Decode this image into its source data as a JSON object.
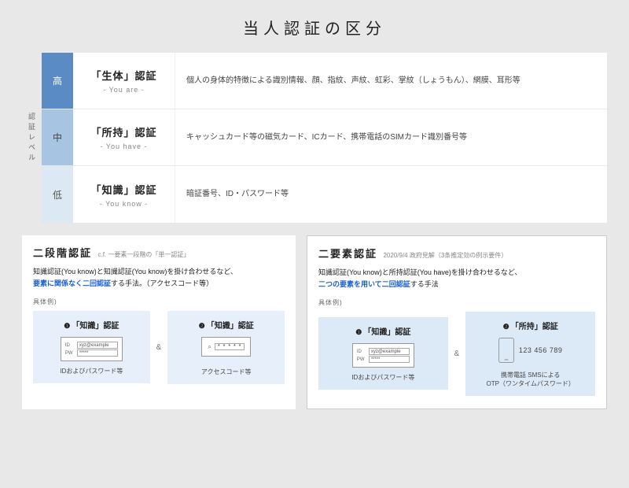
{
  "title": "当人認証の区分",
  "sideLabel": "認証レベル",
  "levels": [
    {
      "level": "高",
      "catTitle": "「生体」認証",
      "catSub": "- You are -",
      "desc": "個人の身体的特徴による識別情報、顔、指紋、声紋、虹彩、掌紋（しょうもん）、網膜、耳形等"
    },
    {
      "level": "中",
      "catTitle": "「所持」認証",
      "catSub": "- You have -",
      "desc": "キャッシュカード等の磁気カード、ICカード、携帯電話のSIMカード識別番号等"
    },
    {
      "level": "低",
      "catTitle": "「知識」認証",
      "catSub": "- You know -",
      "desc": "暗証番号、ID・パスワード等"
    }
  ],
  "twoStep": {
    "title": "二段階認証",
    "note": "c.f. 一要素一段階の「単一認証」",
    "desc1": "知識認証(You know)と知識認証(You know)を掛け合わせるなど、",
    "descHL": "要素に関係なく二回認証",
    "desc2": "する手法。（アクセスコード等）",
    "exampleLabel": "具体例)",
    "card1Title": "「知識」認証",
    "card2Title": "「知識」認証",
    "idLabel": "ID",
    "pwLabel": "PW",
    "idValue": "xyz@example",
    "pwValue": "*****",
    "card1Caption": "IDおよびパスワード等",
    "accessDots": "* * * * *",
    "card2Caption": "アクセスコード等",
    "amp": "&"
  },
  "twoFactor": {
    "title": "二要素認証",
    "note": "2020/9/4 政府見解（3条推定効の例示要件）",
    "desc1": "知識認証(You know)と所持認証(You have)を掛け合わせるなど、",
    "descHL": "二つの要素を用いて二回認証",
    "desc2": "する手法",
    "exampleLabel": "具体例)",
    "card1Title": "「知識」認証",
    "card2Title": "「所持」認証",
    "idLabel": "ID",
    "pwLabel": "PW",
    "idValue": "xyz@example",
    "pwValue": "*****",
    "card1Caption": "IDおよびパスワード等",
    "phoneNum": "123 456 789",
    "card2Caption1": "携帯電話 SMSによる",
    "card2Caption2": "OTP（ワンタイムパスワード）",
    "amp": "&"
  }
}
